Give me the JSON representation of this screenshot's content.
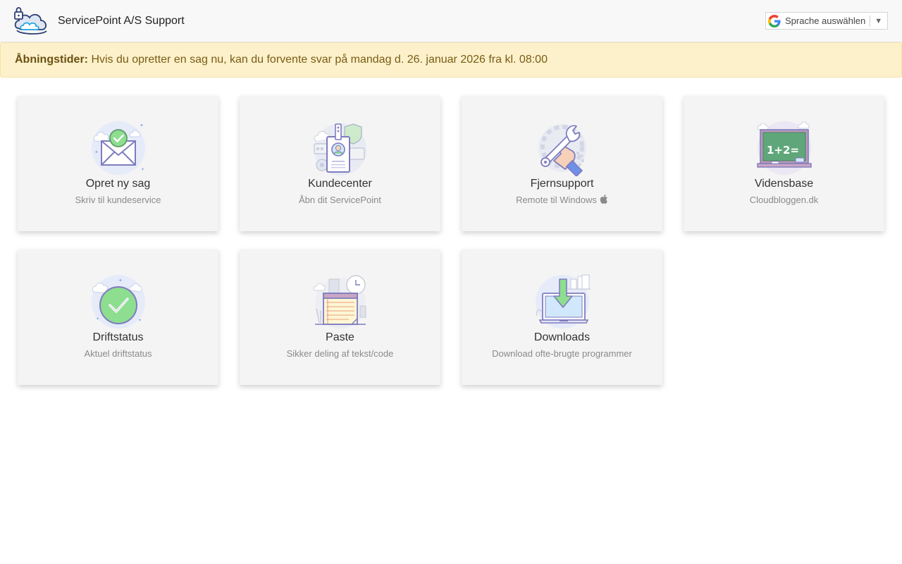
{
  "header": {
    "brand_name": "ServicePoint A/S Support",
    "translate_label": "Sprache auswählen",
    "translate_arrow": "▼"
  },
  "notice": {
    "label": "Åbningstider:",
    "text": " Hvis du opretter en sag nu, kan du forvente svar på mandag d. 26. januar 2026 fra kl. 08:00"
  },
  "cards": [
    {
      "title": "Opret ny sag",
      "subtitle": "Skriv til kundeservice",
      "icon": "envelope-check-icon"
    },
    {
      "title": "Kundecenter",
      "subtitle": "Åbn dit ServicePoint",
      "icon": "id-badge-icon"
    },
    {
      "title": "Fjernsupport",
      "subtitle": "Remote til Windows",
      "icon": "wrench-hand-icon",
      "extra_icon": "apple-icon"
    },
    {
      "title": "Vidensbase",
      "subtitle": "Cloudbloggen.dk",
      "icon": "chalkboard-icon"
    },
    {
      "title": "Driftstatus",
      "subtitle": "Aktuel driftstatus",
      "icon": "status-check-icon"
    },
    {
      "title": "Paste",
      "subtitle": "Sikker deling af tekst/code",
      "icon": "notepad-icon"
    },
    {
      "title": "Downloads",
      "subtitle": "Download ofte-brugte programmer",
      "icon": "laptop-download-icon"
    }
  ],
  "colors": {
    "notice_bg": "#fcf1cb",
    "notice_text": "#7a5c14",
    "card_bg": "#f4f4f4",
    "accent_green": "#8ede8f",
    "accent_purple": "#8a87c9"
  }
}
